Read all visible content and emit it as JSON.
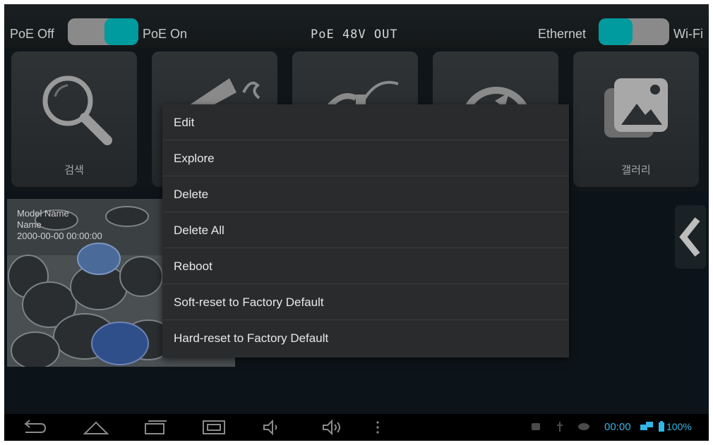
{
  "top": {
    "poe_off": "PoE Off",
    "poe_on": "PoE On",
    "poe_status": "PoE 48V OUT",
    "ethernet": "Ethernet",
    "wifi": "Wi-Fi",
    "accent": "#009b9e"
  },
  "tiles": [
    {
      "label": "검색",
      "icon": "search-icon"
    },
    {
      "label": "",
      "icon": "tools-icon"
    },
    {
      "label": "",
      "icon": "cable-icon"
    },
    {
      "label": "",
      "icon": "refresh-icon"
    },
    {
      "label": "갤러리",
      "icon": "gallery-icon"
    }
  ],
  "camera": {
    "model_name": "Model Name",
    "name": "Name",
    "datetime": "2000-00-00 00:00:00"
  },
  "menu": {
    "items": [
      "Edit",
      "Explore",
      "Delete",
      "Delete All",
      "Reboot",
      "Soft-reset to Factory Default",
      "Hard-reset to Factory Default"
    ]
  },
  "statusbar": {
    "time": "00:00",
    "battery": "100%"
  }
}
